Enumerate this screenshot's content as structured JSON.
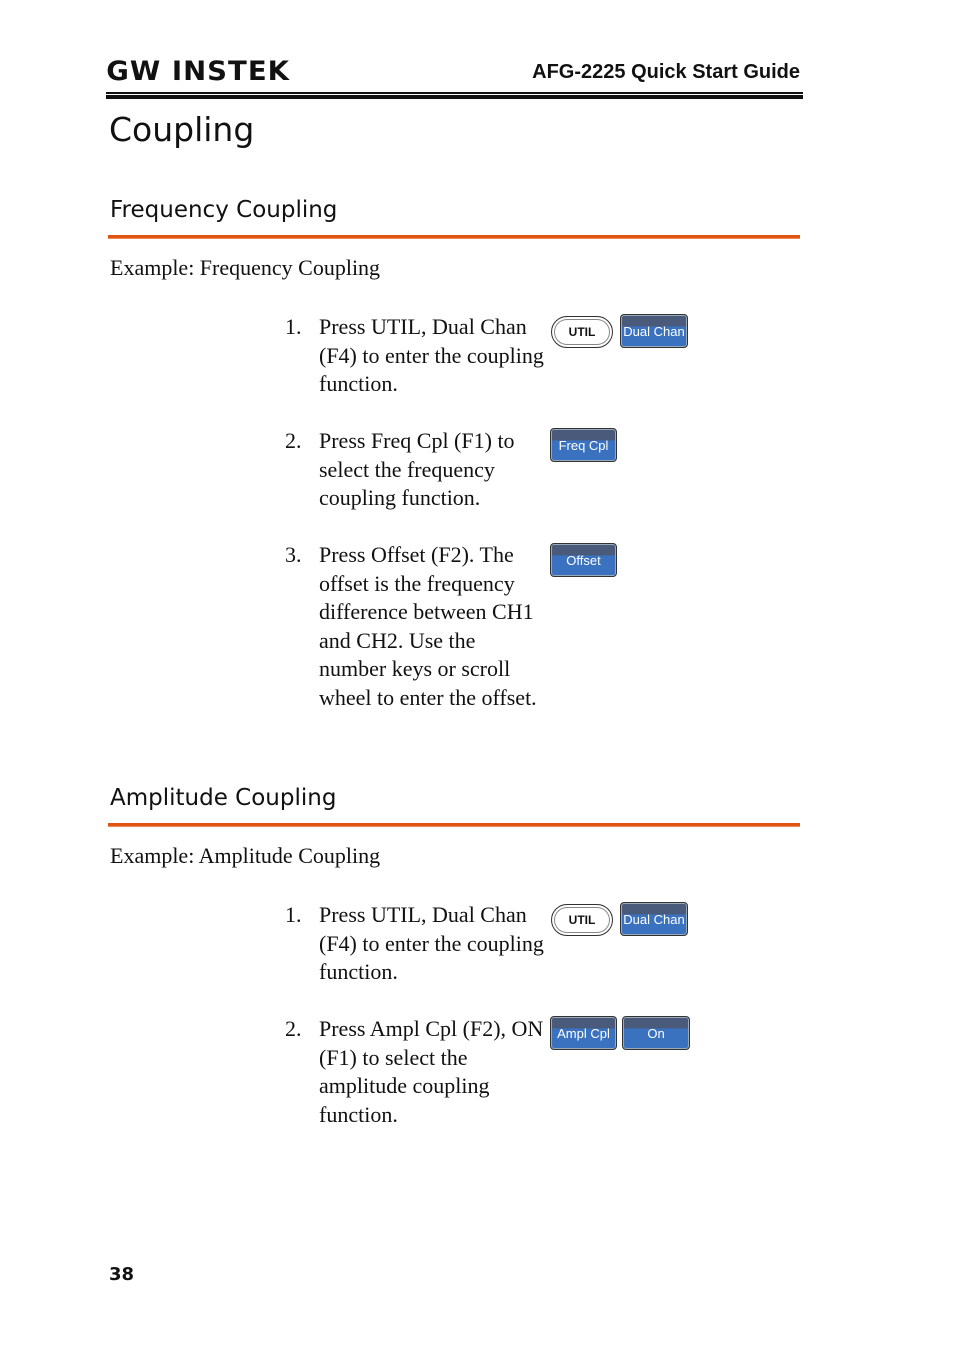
{
  "header": {
    "logo": "GW INSTEK",
    "guide_title": "AFG-2225 Quick Start Guide"
  },
  "page_title": "Coupling",
  "sections": [
    {
      "title": "Frequency Coupling",
      "example": "Example: Frequency Coupling",
      "steps": [
        {
          "num": "1.",
          "text": "Press UTIL, Dual Chan (F4) to enter the coupling function.",
          "keys": [
            "UTIL",
            "Dual Chan"
          ]
        },
        {
          "num": "2.",
          "text": "Press Freq Cpl (F1) to select the frequency coupling function.",
          "keys": [
            "Freq Cpl"
          ]
        },
        {
          "num": "3.",
          "text": "Press Offset (F2). The offset is the frequency difference between CH1 and CH2. Use the number keys or scroll wheel to enter the offset.",
          "keys": [
            "Offset"
          ]
        }
      ]
    },
    {
      "title": "Amplitude Coupling",
      "example": "Example: Amplitude Coupling",
      "steps": [
        {
          "num": "1.",
          "text": "Press UTIL, Dual Chan (F4) to enter the coupling function.",
          "keys": [
            "UTIL",
            "Dual Chan"
          ]
        },
        {
          "num": "2.",
          "text": "Press Ampl Cpl (F2), ON (F1) to select the amplitude coupling function.",
          "keys": [
            "Ampl Cpl",
            "On"
          ]
        }
      ]
    }
  ],
  "page_number": "38",
  "colors": {
    "accent_rule": "#e0520f",
    "softkey_blue": "#3a72c0",
    "softkey_top": "#4a5a7a"
  }
}
